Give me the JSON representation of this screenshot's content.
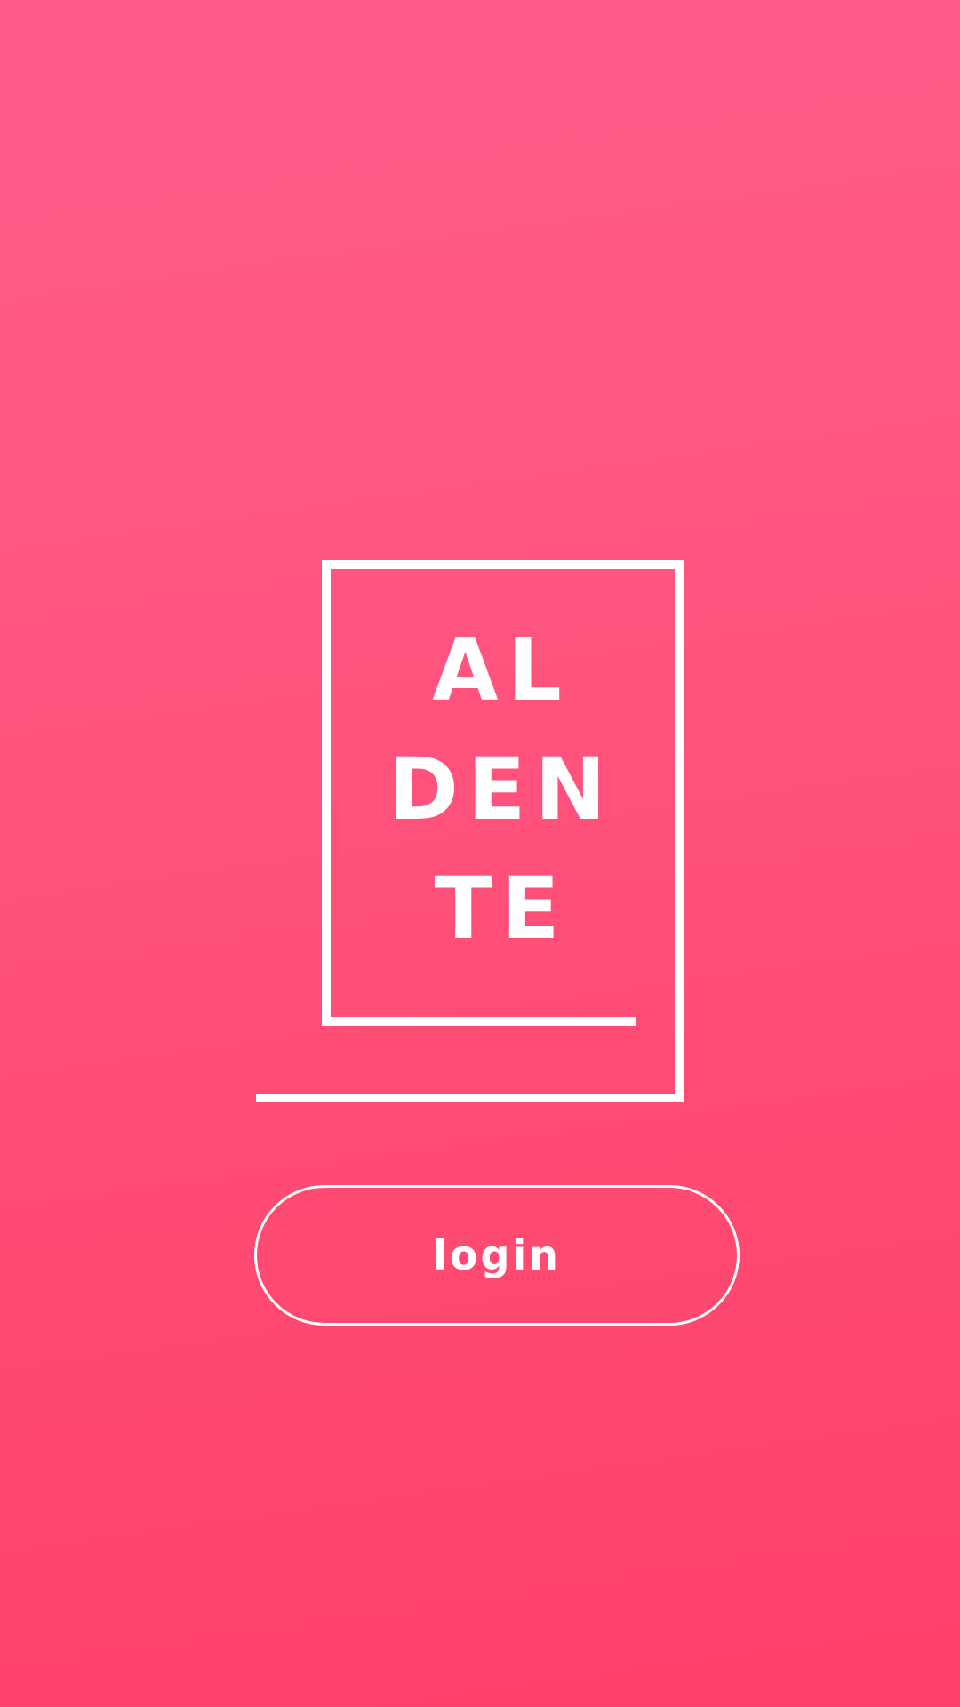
{
  "logo": {
    "line1": "AL",
    "line2": "DEN",
    "line3": "TE"
  },
  "login": {
    "label": "login"
  },
  "colors": {
    "background_top": "#ff5c8a",
    "background_bottom": "#ff4068",
    "foreground": "#ffffff"
  }
}
